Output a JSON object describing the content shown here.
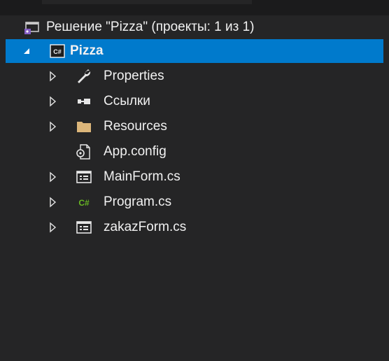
{
  "solution": {
    "label": "Решение \"Pizza\" (проекты: 1 из 1)"
  },
  "project": {
    "label": "Pizza",
    "badge": "C#"
  },
  "items": [
    {
      "label": "Properties",
      "icon": "wrench-icon",
      "expandable": true
    },
    {
      "label": "Ссылки",
      "icon": "references-icon",
      "expandable": true
    },
    {
      "label": "Resources",
      "icon": "folder-icon",
      "expandable": true
    },
    {
      "label": "App.config",
      "icon": "config-file-icon",
      "expandable": false
    },
    {
      "label": "MainForm.cs",
      "icon": "form-icon",
      "expandable": true
    },
    {
      "label": "Program.cs",
      "icon": "csharp-file-icon",
      "expandable": true,
      "badge": "C#"
    },
    {
      "label": "zakazForm.cs",
      "icon": "form-icon",
      "expandable": true
    }
  ],
  "colors": {
    "background": "#252526",
    "selection": "#007acc",
    "text": "#f1f1f1",
    "folder": "#dcb67a",
    "csharp_green": "#68b723",
    "solution_purple": "#865fc5"
  }
}
